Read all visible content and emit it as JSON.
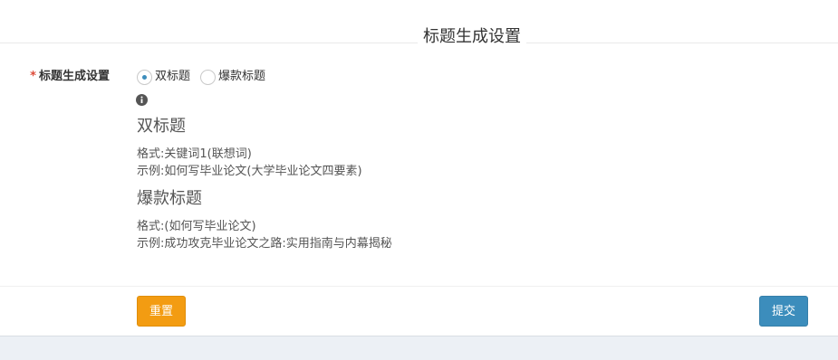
{
  "legend": {
    "title": "标题生成设置"
  },
  "form": {
    "required_mark": "*",
    "label": "标题生成设置",
    "radio_options": [
      {
        "label": "双标题",
        "checked": true
      },
      {
        "label": "爆款标题",
        "checked": false
      }
    ],
    "help": {
      "icon": "info-circle-icon",
      "sections": [
        {
          "heading": "双标题",
          "format": "格式:关键词1(联想词)",
          "example": "示例:如何写毕业论文(大学毕业论文四要素)"
        },
        {
          "heading": "爆款标题",
          "format": "格式:(如何写毕业论文)",
          "example": "示例:成功攻克毕业论文之路:实用指南与内幕揭秘"
        }
      ]
    }
  },
  "actions": {
    "reset_label": "重置",
    "submit_label": "提交"
  },
  "colors": {
    "required_mark": "#dd4b39",
    "radio_checked": "#3c8dbc",
    "reset_button": "#f39c12",
    "submit_button": "#3c8dbc",
    "page_background": "#ecf0f5"
  }
}
